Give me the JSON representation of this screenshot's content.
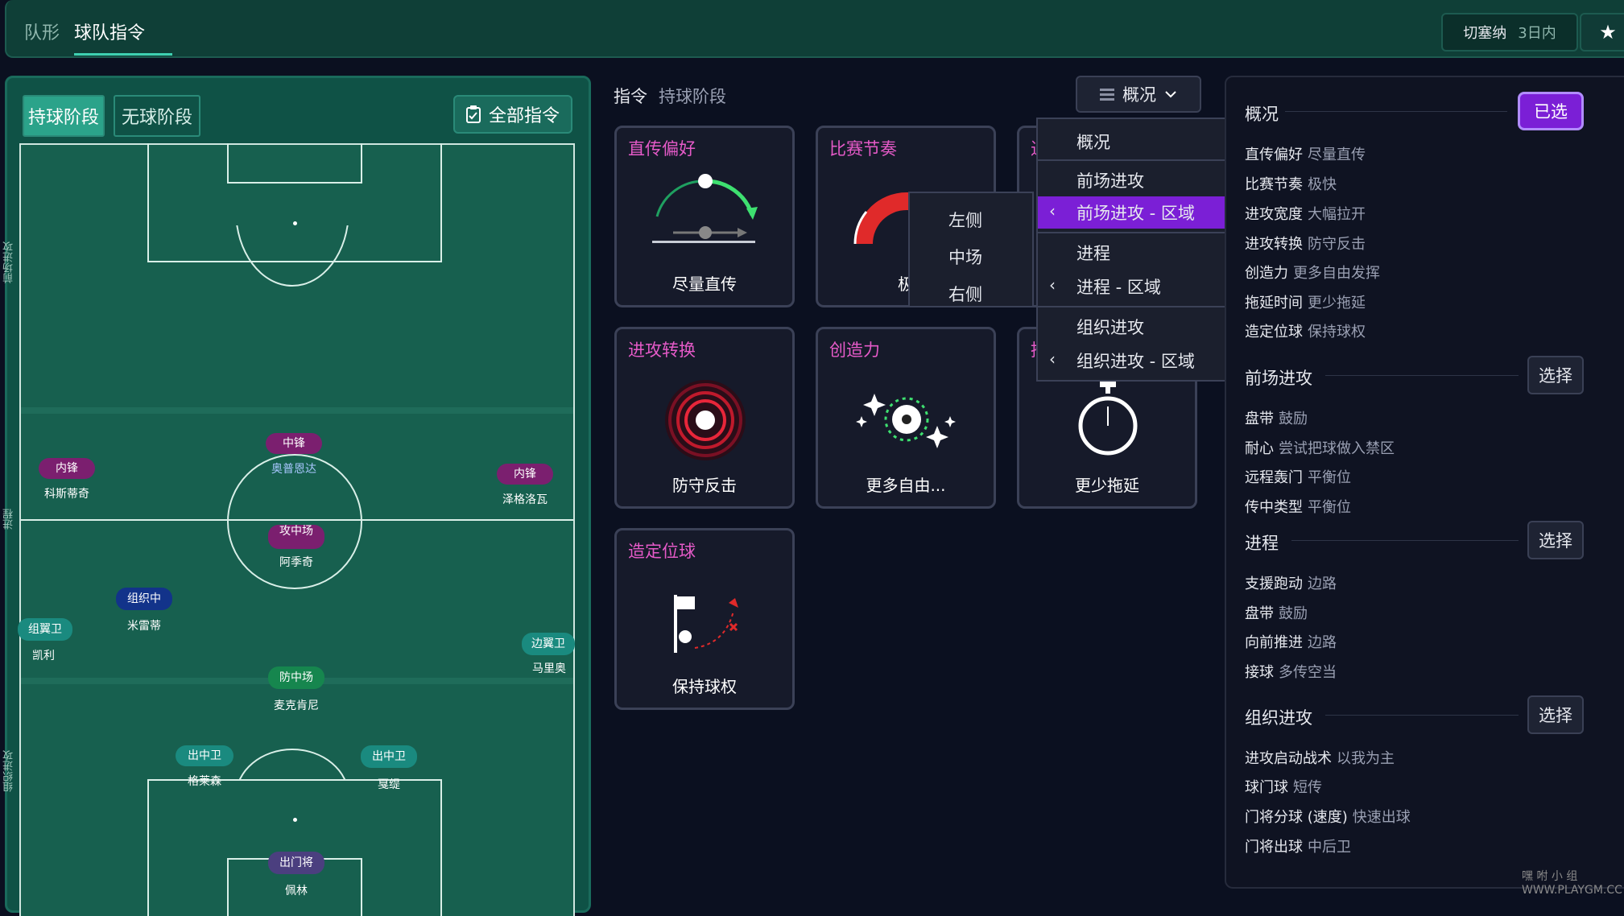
{
  "topbar": {
    "tabs": [
      "队形",
      "球队指令"
    ],
    "opponent": "切塞纳",
    "opponent_time": "3日内",
    "star": "★"
  },
  "left": {
    "phase_in": "持球阶段",
    "phase_out": "无球阶段",
    "all_orders": "全部指令",
    "zones": [
      "前场进攻",
      "进程",
      "组织进攻"
    ],
    "players": [
      {
        "role": "中锋",
        "name": "奥普恩达"
      },
      {
        "role": "内锋",
        "name": "科斯蒂奇"
      },
      {
        "role": "内锋",
        "name": "泽格洛瓦"
      },
      {
        "role": "攻中场",
        "name": "阿季奇"
      },
      {
        "role": "组织中",
        "name": "米雷蒂"
      },
      {
        "role": "组翼卫",
        "name": "凯利"
      },
      {
        "role": "边翼卫",
        "name": "马里奥"
      },
      {
        "role": "防中场",
        "name": "麦克肯尼"
      },
      {
        "role": "出中卫",
        "name": "格莱森"
      },
      {
        "role": "出中卫",
        "name": "戛缇"
      },
      {
        "role": "出门将",
        "name": "佩林"
      }
    ]
  },
  "middle": {
    "title": "指令",
    "subtitle": "持球阶段",
    "overview_btn": "概况",
    "cards": [
      {
        "title": "直传偏好",
        "value": "尽量直传"
      },
      {
        "title": "比赛节奏",
        "value": "极"
      },
      {
        "title": "进攻转换",
        "value": "防守反击"
      },
      {
        "title": "创造力",
        "value": "更多自由..."
      },
      {
        "title": "",
        "value": "更少拖延"
      },
      {
        "title": "造定位球",
        "value": "保持球权"
      }
    ],
    "dropdown": [
      "概况",
      "前场进攻",
      "前场进攻 - 区域",
      "进程",
      "进程 - 区域",
      "组织进攻",
      "组织进攻 - 区域"
    ],
    "submenu": [
      "左侧",
      "中场",
      "右侧"
    ],
    "partial_chars": [
      "进",
      "推"
    ]
  },
  "right": {
    "overview": {
      "title": "概况",
      "btn": "已选",
      "items": [
        {
          "k": "直传偏好",
          "v": "尽量直传"
        },
        {
          "k": "比赛节奏",
          "v": "极快"
        },
        {
          "k": "进攻宽度",
          "v": "大幅拉开"
        },
        {
          "k": "进攻转换",
          "v": "防守反击"
        },
        {
          "k": "创造力",
          "v": "更多自由发挥"
        },
        {
          "k": "拖延时间",
          "v": "更少拖延"
        },
        {
          "k": "造定位球",
          "v": "保持球权"
        }
      ]
    },
    "final": {
      "title": "前场进攻",
      "btn": "选择",
      "items": [
        {
          "k": "盘带",
          "v": "鼓励"
        },
        {
          "k": "耐心",
          "v": "尝试把球做入禁区"
        },
        {
          "k": "远程轰门",
          "v": "平衡位"
        },
        {
          "k": "传中类型",
          "v": "平衡位"
        }
      ]
    },
    "progress": {
      "title": "进程",
      "btn": "选择",
      "items": [
        {
          "k": "支援跑动",
          "v": "边路"
        },
        {
          "k": "盘带",
          "v": "鼓励"
        },
        {
          "k": "向前推进",
          "v": "边路"
        },
        {
          "k": "接球",
          "v": "多传空当"
        }
      ]
    },
    "buildup": {
      "title": "组织进攻",
      "btn": "选择",
      "items": [
        {
          "k": "进攻启动战术",
          "v": "以我为主"
        },
        {
          "k": "球门球",
          "v": "短传"
        },
        {
          "k": "门将分球 (速度)",
          "v": "快速出球"
        },
        {
          "k": "门将出球",
          "v": "中后卫"
        }
      ]
    }
  },
  "watermark": "嘿 咐 小 组 WWW.PLAYGM.CC"
}
